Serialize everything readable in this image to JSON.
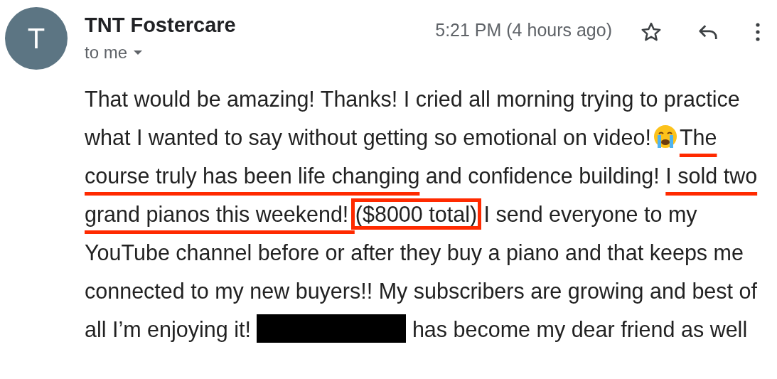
{
  "sender": {
    "initial": "T",
    "name": "TNT Fostercare",
    "recipient": "to me"
  },
  "time": "5:21 PM (4 hours ago)",
  "starred": false,
  "body": [
    {
      "kind": "text",
      "text": "That would be amazing! Thanks! I cried all morning trying to practice what I wanted to say without getting so emotional on video!"
    },
    {
      "kind": "emoji"
    },
    {
      "kind": "underlined",
      "text": "The course truly has been life changing"
    },
    {
      "kind": "text",
      "text": " and confidence building! "
    },
    {
      "kind": "underlined",
      "text": "I sold two grand pianos this weekend! "
    },
    {
      "kind": "boxed",
      "text": "($8000 total)"
    },
    {
      "kind": "text",
      "text": " I send everyone to my YouTube channel before or after they buy a piano and that keeps me connected to my new buyers!! My subscribers are growing and best of all I’m enjoying it! "
    },
    {
      "kind": "redacted"
    },
    {
      "kind": "text",
      "text": " has become my dear friend as well"
    }
  ]
}
